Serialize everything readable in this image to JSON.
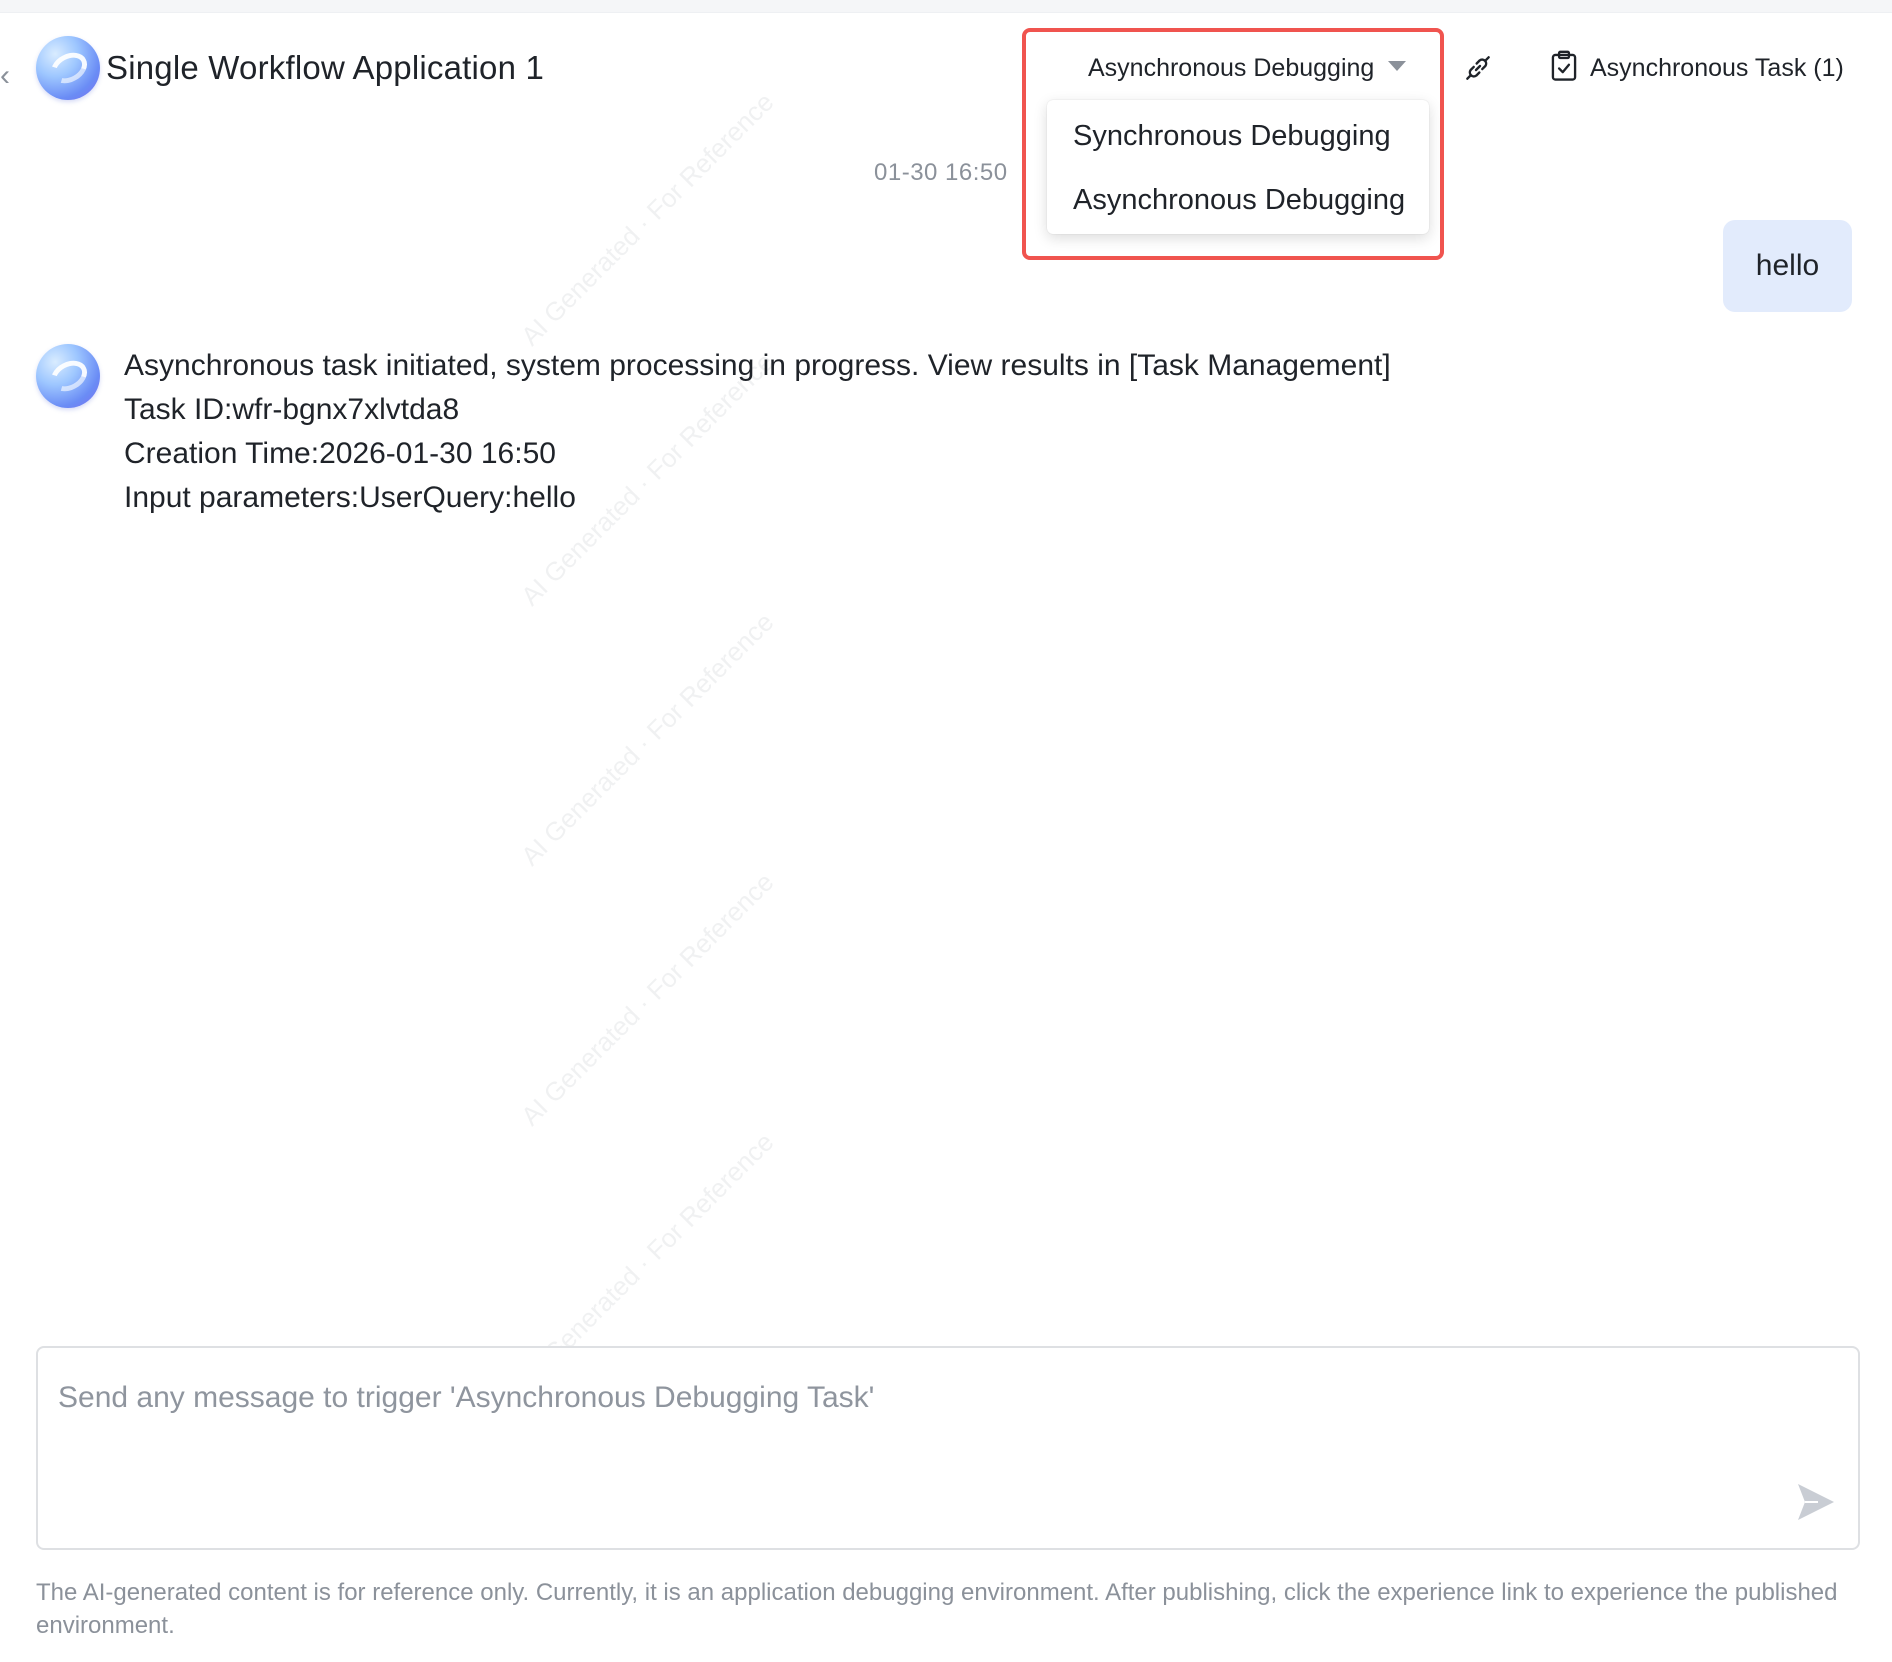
{
  "header": {
    "title": "Single Workflow Application 1",
    "mode_selected": "Asynchronous Debugging",
    "task_button_label": "Asynchronous Task (1)"
  },
  "mode_menu": {
    "options": [
      "Synchronous Debugging",
      "Asynchronous Debugging"
    ]
  },
  "conversation": {
    "timestamp": "01-30 16:50",
    "user_message": "hello",
    "bot_message": {
      "line1": "Asynchronous task initiated, system processing in progress. View results in [Task Management]",
      "line2": "Task ID:wfr-bgnx7xlvtda8",
      "line3": "Creation Time:2026-01-30 16:50",
      "line4": "Input parameters:UserQuery:hello"
    }
  },
  "composer": {
    "placeholder": "Send any message to trigger 'Asynchronous Debugging Task'"
  },
  "footer": {
    "disclaimer": "The AI-generated content is for reference only. Currently, it is an application debugging environment. After publishing, click the experience link to experience the published environment."
  },
  "watermark": {
    "text": "AI Generated · For Reference"
  },
  "icons": {
    "back": "chevron-left-icon",
    "link": "link-icon",
    "task": "clipboard-check-icon",
    "send": "send-icon",
    "caret": "caret-down-icon"
  },
  "colors": {
    "highlight": "#f0544f",
    "user_bubble": "#e2ebfc",
    "muted_text": "#8b919a"
  }
}
